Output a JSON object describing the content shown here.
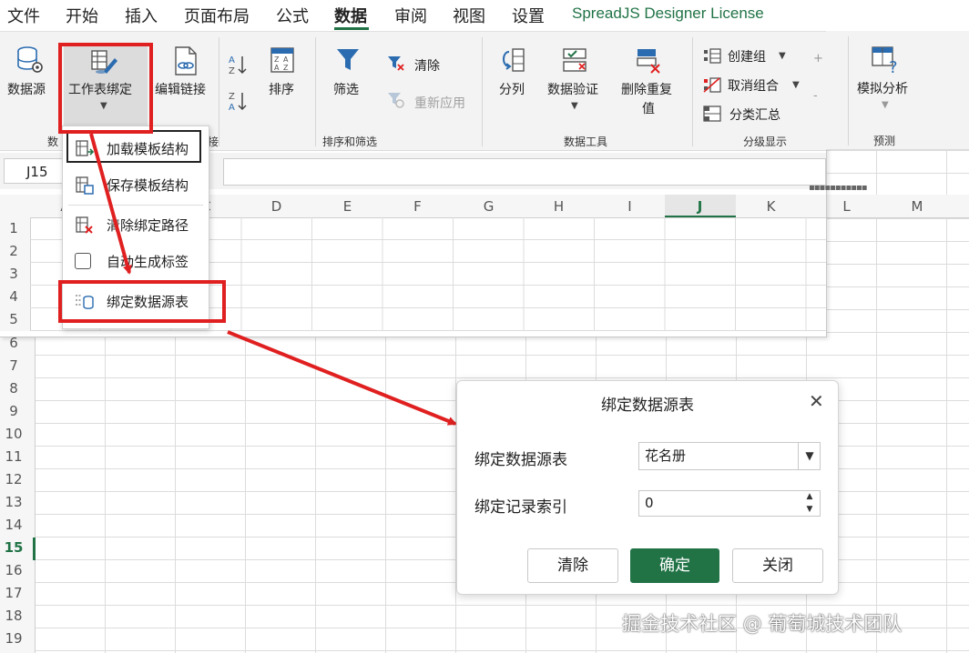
{
  "menu": {
    "items": [
      {
        "label": "文件"
      },
      {
        "label": "开始"
      },
      {
        "label": "插入"
      },
      {
        "label": "页面布局"
      },
      {
        "label": "公式"
      },
      {
        "label": "数据"
      },
      {
        "label": "审阅"
      },
      {
        "label": "视图"
      },
      {
        "label": "设置"
      },
      {
        "label": "SpreadJS Designer License"
      }
    ],
    "active": "数据"
  },
  "ribbon": {
    "data_source": "数据源",
    "sheet_binding": "工作表绑定",
    "edit_link": "编辑链接",
    "group_data_prefix": "数",
    "group_data_suffix": "接",
    "sort": "排序",
    "filter": "筛选",
    "clear": "清除",
    "reapply": "重新应用",
    "group_sort_filter": "排序和筛选",
    "split_column": "分列",
    "data_validation": "数据验证",
    "remove_dup_line1": "删除重复",
    "remove_dup_line2": "值",
    "group_data_tools": "数据工具",
    "create_group": "创建组",
    "ungroup": "取消组合",
    "subtotal": "分类汇总",
    "group_outline": "分级显示",
    "what_if": "模拟分析",
    "group_forecast": "预测"
  },
  "formula_bar": {
    "name_box": "J15",
    "formula": ""
  },
  "grid": {
    "columns": [
      "A",
      "B",
      "C",
      "D",
      "E",
      "F",
      "G",
      "H",
      "I",
      "J",
      "K"
    ],
    "outer_columns": [
      "L",
      "M"
    ],
    "inner_rows": [
      "1",
      "2",
      "3",
      "4",
      "5"
    ],
    "outer_rows": [
      "6",
      "7",
      "8",
      "9",
      "10",
      "11",
      "12",
      "13",
      "14",
      "15",
      "16",
      "17",
      "18",
      "19"
    ],
    "active_row": "15",
    "active_column": "J"
  },
  "dropdown": {
    "items": [
      {
        "label": "加载模板结构"
      },
      {
        "label": "保存模板结构"
      },
      {
        "label": "清除绑定路径"
      },
      {
        "label": "自动生成标签"
      },
      {
        "label": "绑定数据源表"
      }
    ]
  },
  "dialog": {
    "title": "绑定数据源表",
    "table_label": "绑定数据源表",
    "table_value": "花名册",
    "index_label": "绑定记录索引",
    "index_value": "0",
    "clear_button": "清除",
    "ok_button": "确定",
    "close_button": "关闭"
  },
  "watermark": "掘金技术社区 @ 葡萄城技术团队",
  "colors": {
    "accent": "#217346",
    "annotation": "#e02020"
  }
}
